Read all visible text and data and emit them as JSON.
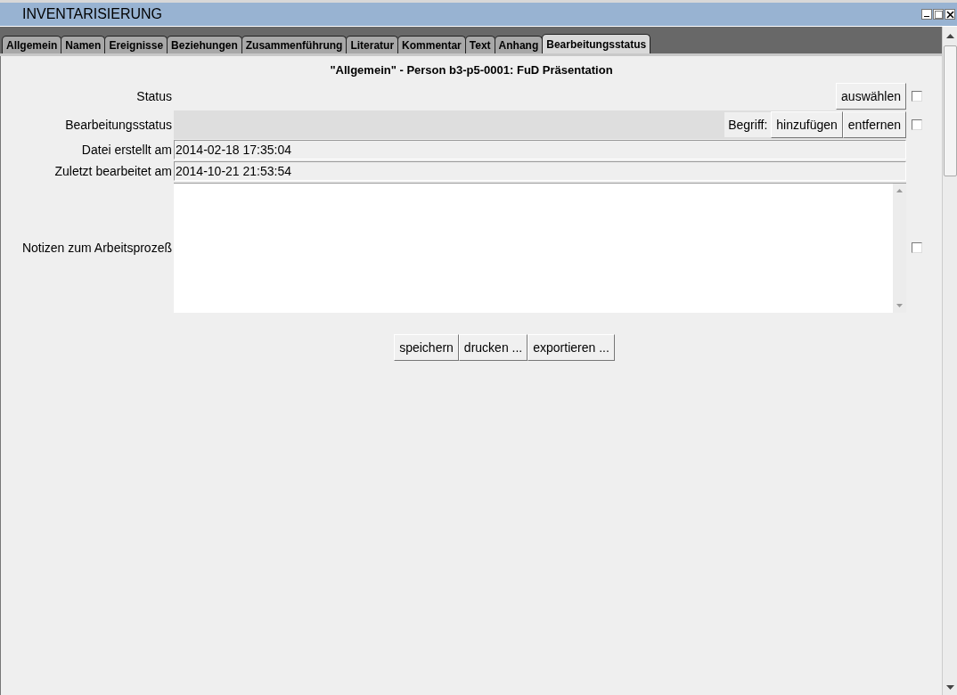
{
  "window": {
    "title": "INVENTARISIERUNG"
  },
  "tabs": [
    {
      "label": "Allgemein",
      "selected": false
    },
    {
      "label": "Namen",
      "selected": false
    },
    {
      "label": "Ereignisse",
      "selected": false
    },
    {
      "label": "Beziehungen",
      "selected": false
    },
    {
      "label": "Zusammenführung",
      "selected": false
    },
    {
      "label": "Literatur",
      "selected": false
    },
    {
      "label": "Kommentar",
      "selected": false
    },
    {
      "label": "Text",
      "selected": false
    },
    {
      "label": "Anhang",
      "selected": false
    },
    {
      "label": "Bearbeitungsstatus",
      "selected": true
    }
  ],
  "heading": "\"Allgemein\" - Person b3-p5-0001: FuD Präsentation",
  "fields": [
    {
      "kind": "select",
      "label": "Status",
      "buttons": [
        "auswählen"
      ],
      "checked": false
    },
    {
      "kind": "terms",
      "label": "Bearbeitungsstatus",
      "term_label": "Begriff:",
      "buttons": [
        "hinzufügen",
        "entfernen"
      ],
      "checked": false
    },
    {
      "kind": "readonly",
      "label": "Datei erstellt am",
      "value": "2014-02-18 17:35:04"
    },
    {
      "kind": "readonly",
      "label": "Zuletzt bearbeitet am",
      "value": "2014-10-21 21:53:54"
    },
    {
      "kind": "textarea",
      "label": "Notizen zum Arbeitsprozeß",
      "checked": false
    }
  ],
  "buttons": [
    "speichern",
    "drucken ...",
    "exportieren ..."
  ]
}
